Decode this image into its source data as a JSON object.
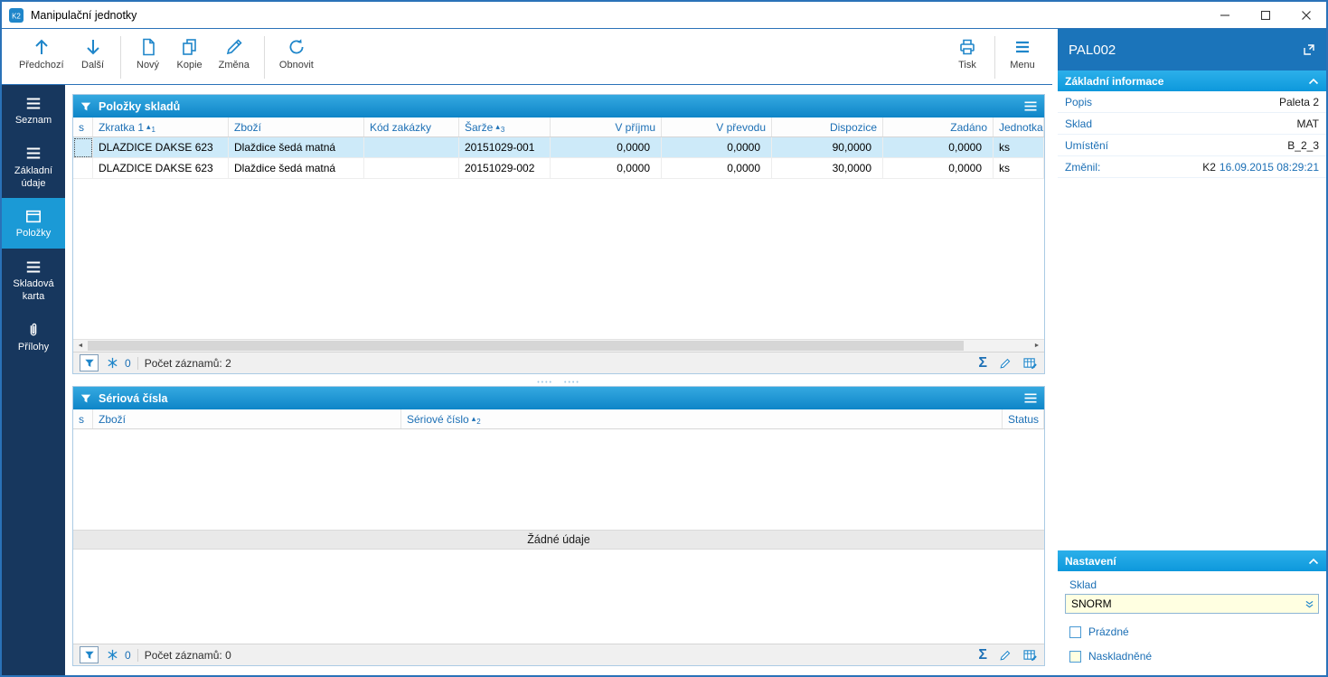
{
  "window": {
    "title": "Manipulační jednotky"
  },
  "toolbar": {
    "previous": "Předchozí",
    "next": "Další",
    "new": "Nový",
    "copy": "Kopie",
    "change": "Změna",
    "refresh": "Obnovit",
    "print": "Tisk",
    "menu": "Menu"
  },
  "sidebar": {
    "items": [
      {
        "label": "Seznam",
        "active": false
      },
      {
        "label": "Základní údaje",
        "active": false
      },
      {
        "label": "Položky",
        "active": true
      },
      {
        "label": "Skladová karta",
        "active": false
      },
      {
        "label": "Přílohy",
        "active": false
      }
    ]
  },
  "stock_items": {
    "title": "Položky skladů",
    "columns": {
      "s": "s",
      "zkratka": "Zkratka 1",
      "zkratka_sort": "1",
      "zbozi": "Zboží",
      "kod_zakazky": "Kód zakázky",
      "sarze": "Šarže",
      "sarze_sort": "3",
      "v_prijmu": "V příjmu",
      "v_prevodu": "V převodu",
      "dispozice": "Dispozice",
      "zadano": "Zadáno",
      "jednotka": "Jednotka"
    },
    "rows": [
      {
        "zkratka": "DLAZDICE DAKSE 623",
        "zbozi": "Dlaždice šedá matná",
        "kod_zakazky": "",
        "sarze": "20151029-001",
        "v_prijmu": "0,0000",
        "v_prevodu": "0,0000",
        "dispozice": "90,0000",
        "zadano": "0,0000",
        "jednotka": "ks"
      },
      {
        "zkratka": "DLAZDICE DAKSE 623",
        "zbozi": "Dlaždice šedá matná",
        "kod_zakazky": "",
        "sarze": "20151029-002",
        "v_prijmu": "0,0000",
        "v_prevodu": "0,0000",
        "dispozice": "30,0000",
        "zadano": "0,0000",
        "jednotka": "ks"
      }
    ],
    "status": {
      "filter_count": "0",
      "records": "Počet záznamů: 2"
    }
  },
  "serial_numbers": {
    "title": "Sériová čísla",
    "columns": {
      "s": "s",
      "zbozi": "Zboží",
      "seriove_cislo": "Sériové číslo",
      "seriove_sort": "2",
      "status": "Status"
    },
    "empty_text": "Žádné údaje",
    "status": {
      "filter_count": "0",
      "records": "Počet záznamů: 0"
    }
  },
  "detail": {
    "title": "PAL002",
    "basic_info": {
      "header": "Základní informace",
      "rows": [
        {
          "label": "Popis",
          "value": "Paleta 2"
        },
        {
          "label": "Sklad",
          "value": "MAT"
        },
        {
          "label": "Umístění",
          "value": "B_2_3"
        },
        {
          "label": "Změnil:",
          "value": "K2",
          "value_date": "16.09.2015 08:29:21"
        }
      ]
    },
    "settings": {
      "header": "Nastavení",
      "warehouse_label": "Sklad",
      "warehouse_value": "SNORM",
      "checkbox_empty": {
        "label": "Prázdné",
        "checked": false
      },
      "checkbox_stocked": {
        "label": "Naskladněné",
        "checked": false
      }
    }
  },
  "colors": {
    "accent_blue": "#1f86ca",
    "sidebar_navy": "#17375e",
    "sidebar_active": "#1b9ad6",
    "panel_header": "#0e85c8",
    "detail_blue": "#1b74ba",
    "selected_row": "#cdeaf9",
    "field_cream": "#ffffe1"
  },
  "icons": {
    "sum": "Σ",
    "sort_asc": "▴",
    "scroll_left": "◄",
    "scroll_right": "►"
  }
}
